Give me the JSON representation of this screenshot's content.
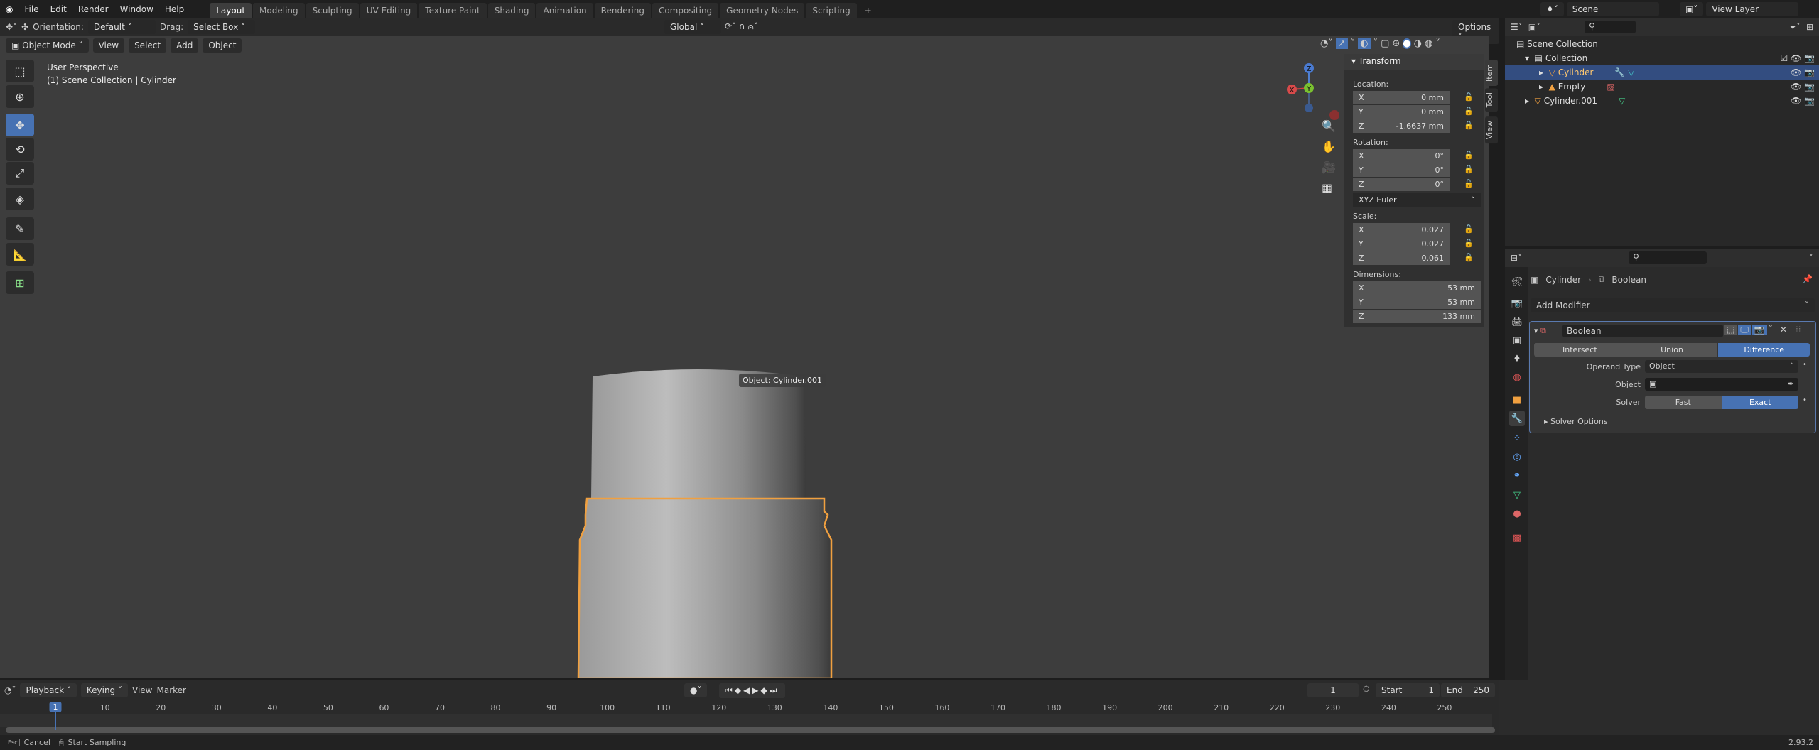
{
  "menubar": {
    "items": [
      "File",
      "Edit",
      "Render",
      "Window",
      "Help"
    ],
    "workspaces": [
      "Layout",
      "Modeling",
      "Sculpting",
      "UV Editing",
      "Texture Paint",
      "Shading",
      "Animation",
      "Rendering",
      "Compositing",
      "Geometry Nodes",
      "Scripting"
    ],
    "active_workspace": "Layout",
    "add_tab": "+",
    "scene": "Scene",
    "view_layer": "View Layer"
  },
  "tool_header": {
    "orientation_label": "Orientation:",
    "orientation_value": "Default",
    "drag_label": "Drag:",
    "drag_value": "Select Box",
    "transform_orientation": "Global",
    "options": "Options"
  },
  "viewport_header": {
    "mode": "Object Mode",
    "menus": [
      "View",
      "Select",
      "Add",
      "Object"
    ]
  },
  "viewport": {
    "perspective": "User Perspective",
    "context": "(1) Scene Collection | Cylinder",
    "tooltip": "Object: Cylinder.001",
    "gizmo": {
      "x": "X",
      "y": "Y",
      "z": "Z"
    },
    "selection_color": "#f0a040"
  },
  "toolbar": {
    "active_tool": "move",
    "tools": [
      "select-box",
      "cursor",
      "move",
      "rotate",
      "scale",
      "transform",
      "annotate",
      "measure",
      "add-cube"
    ]
  },
  "sidebar": {
    "title": "Transform",
    "tabs": [
      "Item",
      "Tool",
      "View"
    ],
    "location_label": "Location:",
    "location": [
      {
        "axis": "X",
        "value": "0 mm"
      },
      {
        "axis": "Y",
        "value": "0 mm"
      },
      {
        "axis": "Z",
        "value": "-1.6637 mm"
      }
    ],
    "rotation_label": "Rotation:",
    "rotation": [
      {
        "axis": "X",
        "value": "0°"
      },
      {
        "axis": "Y",
        "value": "0°"
      },
      {
        "axis": "Z",
        "value": "0°"
      }
    ],
    "rotation_mode": "XYZ Euler",
    "scale_label": "Scale:",
    "scale": [
      {
        "axis": "X",
        "value": "0.027"
      },
      {
        "axis": "Y",
        "value": "0.027"
      },
      {
        "axis": "Z",
        "value": "0.061"
      }
    ],
    "dimensions_label": "Dimensions:",
    "dimensions": [
      {
        "axis": "X",
        "value": "53 mm"
      },
      {
        "axis": "Y",
        "value": "53 mm"
      },
      {
        "axis": "Z",
        "value": "133 mm"
      }
    ]
  },
  "outliner": {
    "root": "Scene Collection",
    "items": [
      {
        "name": "Collection",
        "level": 0
      },
      {
        "name": "Cylinder",
        "level": 1,
        "selected": true
      },
      {
        "name": "Empty",
        "level": 1
      },
      {
        "name": "Cylinder.001",
        "level": 0
      }
    ]
  },
  "properties": {
    "breadcrumb_object": "Cylinder",
    "breadcrumb_modifier": "Boolean",
    "add_modifier": "Add Modifier",
    "modifier_name": "Boolean",
    "operations": [
      "Intersect",
      "Union",
      "Difference"
    ],
    "active_operation": "Difference",
    "operand_type_label": "Operand Type",
    "operand_type": "Object",
    "object_label": "Object",
    "object_value": "",
    "solver_label": "Solver",
    "solvers": [
      "Fast",
      "Exact"
    ],
    "active_solver": "Exact",
    "solver_options": "Solver Options"
  },
  "timeline": {
    "menus": [
      "Playback",
      "Keying",
      "View",
      "Marker"
    ],
    "current_frame": "1",
    "start_label": "Start",
    "start": "1",
    "end_label": "End",
    "end": "250",
    "ticks": [
      "1",
      "10",
      "20",
      "30",
      "40",
      "50",
      "60",
      "70",
      "80",
      "90",
      "100",
      "110",
      "120",
      "130",
      "140",
      "150",
      "160",
      "170",
      "180",
      "190",
      "200",
      "210",
      "220",
      "230",
      "240",
      "250"
    ]
  },
  "statusbar": {
    "esc": "Esc",
    "cancel": "Cancel",
    "action": "Start Sampling",
    "version": "2.93.2"
  }
}
